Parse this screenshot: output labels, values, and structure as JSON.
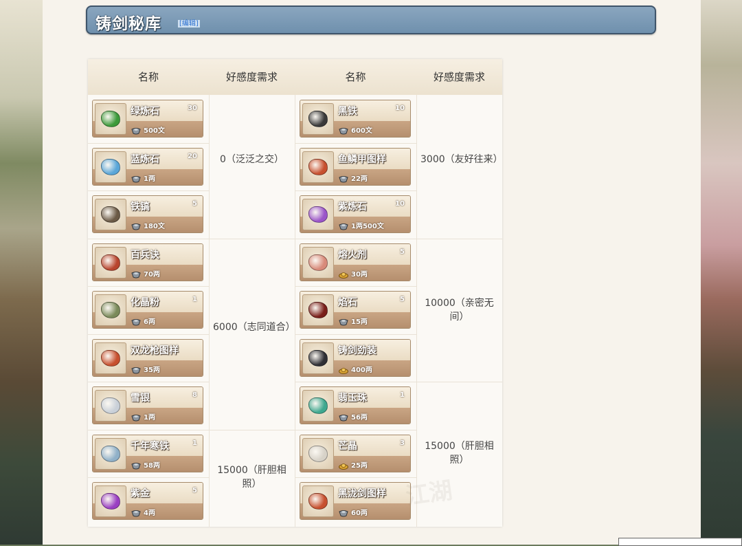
{
  "section": {
    "title": "铸剑秘库",
    "edit_label": "[编辑]"
  },
  "table": {
    "headers": [
      "名称",
      "好感度需求",
      "名称",
      "好感度需求"
    ],
    "left_items": [
      {
        "name": "绿炼石",
        "count": "30",
        "price": "500文",
        "currency": "silver",
        "color": "#3c9a3a"
      },
      {
        "name": "蓝炼石",
        "count": "20",
        "price": "1两",
        "currency": "silver",
        "color": "#5aa6d8"
      },
      {
        "name": "铁镐",
        "count": "5",
        "price": "180文",
        "currency": "silver",
        "color": "#6b5a46"
      },
      {
        "name": "百兵诀",
        "count": "",
        "price": "70两",
        "currency": "silver",
        "color": "#b8452e"
      },
      {
        "name": "化晶粉",
        "count": "1",
        "price": "6两",
        "currency": "silver",
        "color": "#7a8a5a"
      },
      {
        "name": "双龙枪图样",
        "count": "",
        "price": "35两",
        "currency": "silver",
        "color": "#c7502f"
      },
      {
        "name": "雪银",
        "count": "8",
        "price": "1两",
        "currency": "silver",
        "color": "#c9d0d8"
      },
      {
        "name": "千年寒铁",
        "count": "1",
        "price": "58两",
        "currency": "silver",
        "color": "#8fb0c8"
      },
      {
        "name": "紫金",
        "count": "5",
        "price": "4两",
        "currency": "silver",
        "color": "#9a3fc2"
      }
    ],
    "right_items": [
      {
        "name": "黑铁",
        "count": "10",
        "price": "600文",
        "currency": "silver",
        "color": "#3a3a3a"
      },
      {
        "name": "鱼鳞甲图样",
        "count": "",
        "price": "22两",
        "currency": "silver",
        "color": "#c7502f"
      },
      {
        "name": "紫炼石",
        "count": "10",
        "price": "1两500文",
        "currency": "silver",
        "color": "#9b55c9"
      },
      {
        "name": "熔火剂",
        "count": "5",
        "price": "30两",
        "currency": "gold",
        "color": "#d88a7a"
      },
      {
        "name": "焰石",
        "count": "5",
        "price": "15两",
        "currency": "silver",
        "color": "#7a1f1a"
      },
      {
        "name": "铸剑劲装",
        "count": "",
        "price": "400两",
        "currency": "gold",
        "color": "#2f2f35"
      },
      {
        "name": "翡玉珠",
        "count": "1",
        "price": "56两",
        "currency": "silver",
        "color": "#3fa88f"
      },
      {
        "name": "芒晶",
        "count": "3",
        "price": "25两",
        "currency": "gold",
        "color": "#d7d2c8"
      },
      {
        "name": "黑泷剑图样",
        "count": "",
        "price": "60两",
        "currency": "silver",
        "color": "#c7502f"
      }
    ],
    "left_requirements": [
      "0（泛泛之交）",
      "6000（志同道合）",
      "15000（肝胆相照）"
    ],
    "right_requirements": [
      "3000（友好往来）",
      "10000（亲密无间）",
      "15000（肝胆相照）"
    ]
  },
  "watermark": "江湖"
}
